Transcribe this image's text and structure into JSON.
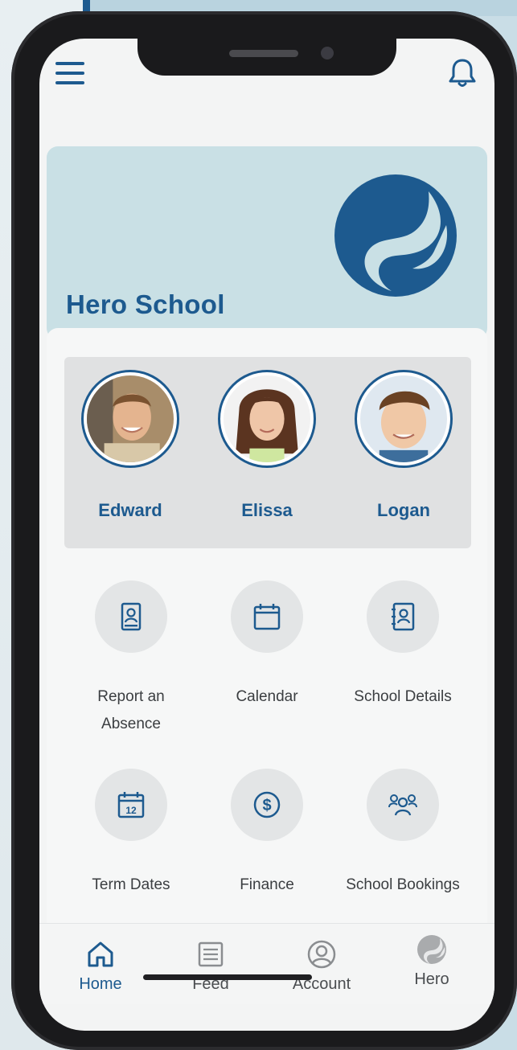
{
  "header": {
    "menu_icon": "menu-icon",
    "notification_icon": "bell-icon"
  },
  "school": {
    "name": "Hero School",
    "logo": "hero-logo"
  },
  "students": [
    {
      "name": "Edward"
    },
    {
      "name": "Elissa"
    },
    {
      "name": "Logan"
    }
  ],
  "tiles": [
    {
      "label": "Report an Absence",
      "icon": "absence-report-icon"
    },
    {
      "label": "Calendar",
      "icon": "calendar-icon"
    },
    {
      "label": "School Details",
      "icon": "contact-book-icon"
    },
    {
      "label": "Term Dates",
      "icon": "calendar-12-icon"
    },
    {
      "label": "Finance",
      "icon": "dollar-icon"
    },
    {
      "label": "School Bookings",
      "icon": "group-icon"
    }
  ],
  "tabbar": {
    "items": [
      {
        "label": "Home",
        "icon": "home-icon",
        "active": true
      },
      {
        "label": "Feed",
        "icon": "feed-icon",
        "active": false
      },
      {
        "label": "Account",
        "icon": "account-icon",
        "active": false
      },
      {
        "label": "Hero",
        "icon": "hero-icon",
        "active": false
      }
    ]
  },
  "colors": {
    "brand": "#1d5a8f",
    "hero_bg": "#c9e0e5",
    "tile_circle": "#e3e5e6"
  }
}
